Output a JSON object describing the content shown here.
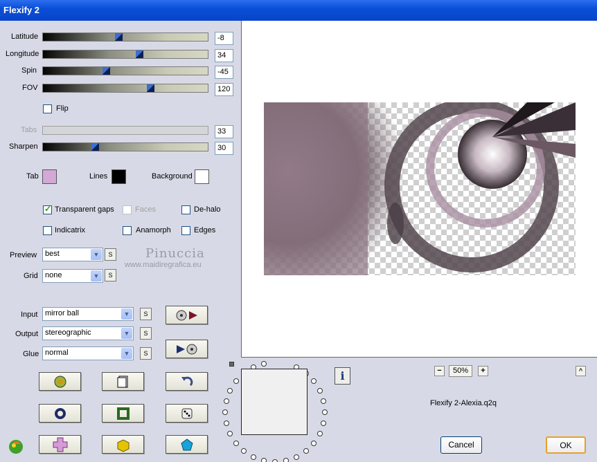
{
  "window": {
    "title": "Flexify 2"
  },
  "sliders": [
    {
      "label": "Latitude",
      "value": "-8",
      "level": 0.46
    },
    {
      "label": "Longitude",
      "value": "34",
      "level": 0.59
    },
    {
      "label": "Spin",
      "value": "-45",
      "level": 0.38
    },
    {
      "label": "FOV",
      "value": "120",
      "level": 0.66
    }
  ],
  "flip": {
    "label": "Flip",
    "checked": false
  },
  "tabs": {
    "label": "Tabs",
    "value": "33",
    "disabled": true
  },
  "sharpen": {
    "label": "Sharpen",
    "value": "30",
    "level": 0.31
  },
  "colors": {
    "tab_label": "Tab",
    "tab_color": "#d4a8d6",
    "lines_label": "Lines",
    "lines_color": "#000000",
    "background_label": "Background",
    "background_color": "#ffffff"
  },
  "options": {
    "transparent_gaps": {
      "label": "Transparent gaps",
      "checked": true
    },
    "faces": {
      "label": "Faces",
      "checked": false,
      "disabled": true
    },
    "de_halo": {
      "label": "De-halo",
      "checked": false
    },
    "indicatrix": {
      "label": "Indicatrix",
      "checked": false
    },
    "anamorph": {
      "label": "Anamorph",
      "checked": false
    },
    "edges": {
      "label": "Edges",
      "checked": false
    }
  },
  "preview": {
    "label": "Preview",
    "value": "best"
  },
  "grid": {
    "label": "Grid",
    "value": "none"
  },
  "watermark": {
    "name": "Pinuccia",
    "site": "www.maidiregrafica.eu"
  },
  "input": {
    "label": "Input",
    "value": "mirror ball"
  },
  "output": {
    "label": "Output",
    "value": "stereographic"
  },
  "glue": {
    "label": "Glue",
    "value": "normal"
  },
  "s_button": "S",
  "zoom": {
    "minus": "−",
    "value": "50%",
    "plus": "+"
  },
  "caret": "^",
  "info_label": "i",
  "preset_name": "Flexify 2-Alexia.q2q",
  "buttons": {
    "cancel": "Cancel",
    "ok": "OK"
  }
}
